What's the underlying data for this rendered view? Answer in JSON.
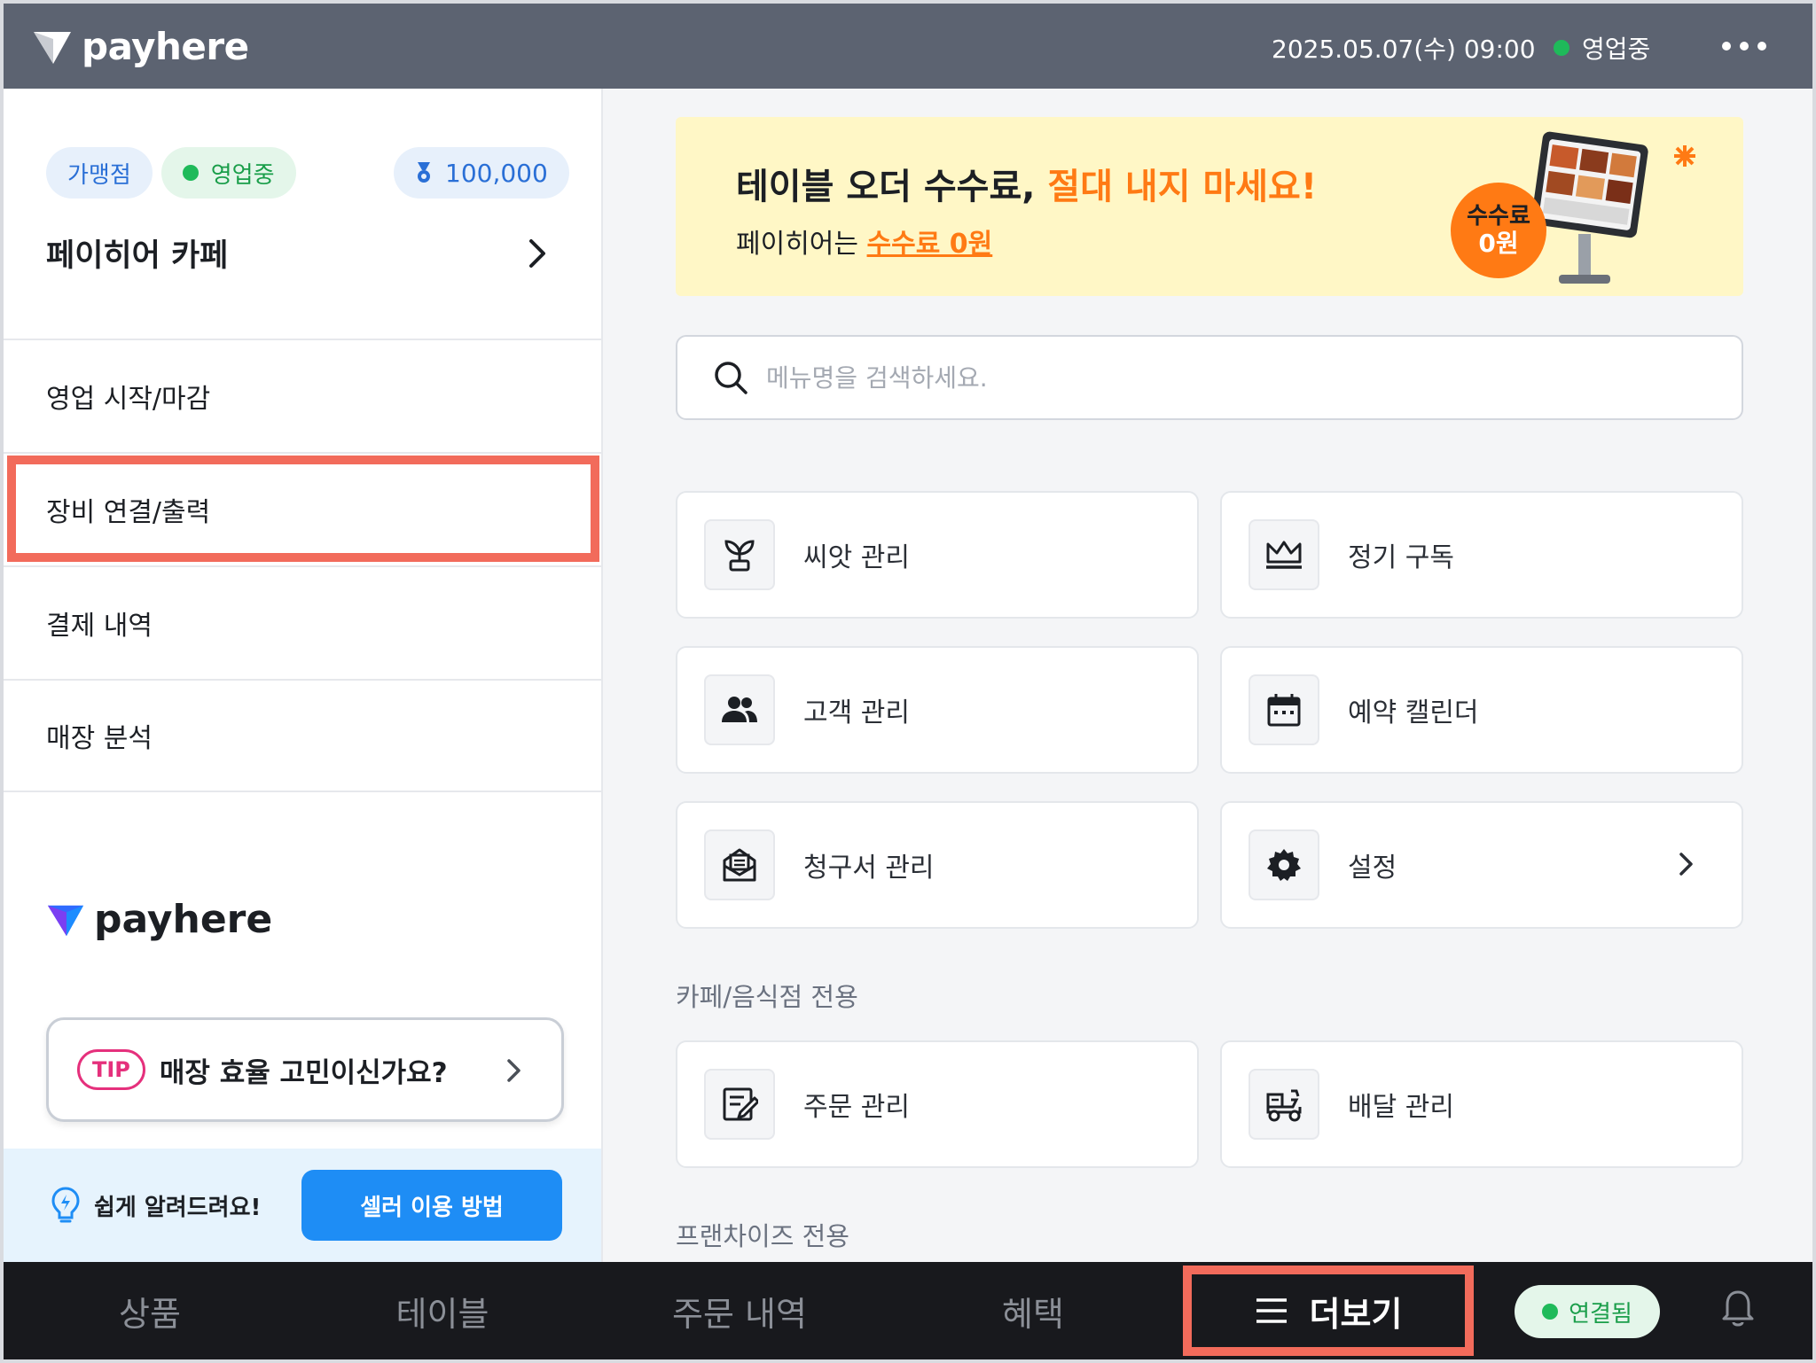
{
  "topbar": {
    "brand": "payhere",
    "datetime": "2025.05.07(수) 09:00",
    "status": "영업중",
    "status_color": "#1fba5a",
    "more_icon": "more-horizontal-icon"
  },
  "sidebar": {
    "badges": {
      "franchise": "가맹점",
      "status": "영업중",
      "points": "100,000"
    },
    "store_name": "페이히어 카페",
    "menu": [
      {
        "label": "영업 시작/마감"
      },
      {
        "label": "장비 연결/출력",
        "highlighted": true
      },
      {
        "label": "결제 내역"
      },
      {
        "label": "매장 분석"
      }
    ],
    "brand": "payhere",
    "tip": {
      "tag": "TIP",
      "text": "매장 효율 고민이신가요?"
    },
    "help": {
      "text": "쉽게 알려드려요!",
      "button": "셀러 이용 방법"
    }
  },
  "banner": {
    "title_plain": "테이블 오더 수수료,",
    "title_accent": "절대 내지 마세요!",
    "sub_plain": "페이히어는",
    "sub_accent": "수수료 0원",
    "badge_line1": "수수료",
    "badge_line2": "0원"
  },
  "search": {
    "placeholder": "메뉴명을 검색하세요."
  },
  "menu_cards": [
    {
      "label": "씨앗 관리",
      "icon": "sprout-icon"
    },
    {
      "label": "정기 구독",
      "icon": "crown-icon"
    },
    {
      "label": "고객 관리",
      "icon": "customers-icon"
    },
    {
      "label": "예약 캘린더",
      "icon": "calendar-icon"
    },
    {
      "label": "청구서 관리",
      "icon": "invoice-icon"
    },
    {
      "label": "설정",
      "icon": "gear-icon"
    }
  ],
  "sections": {
    "cafe": "카페/음식점 전용",
    "franchise": "프랜차이즈 전용"
  },
  "cafe_cards": [
    {
      "label": "주문 관리",
      "icon": "order-edit-icon"
    },
    {
      "label": "배달 관리",
      "icon": "delivery-icon"
    }
  ],
  "bottom_nav": {
    "items": [
      "상품",
      "테이블",
      "주문 내역",
      "혜택"
    ],
    "more": "더보기",
    "connection": "연결됨",
    "accent_highlight": "#f26b5b"
  }
}
